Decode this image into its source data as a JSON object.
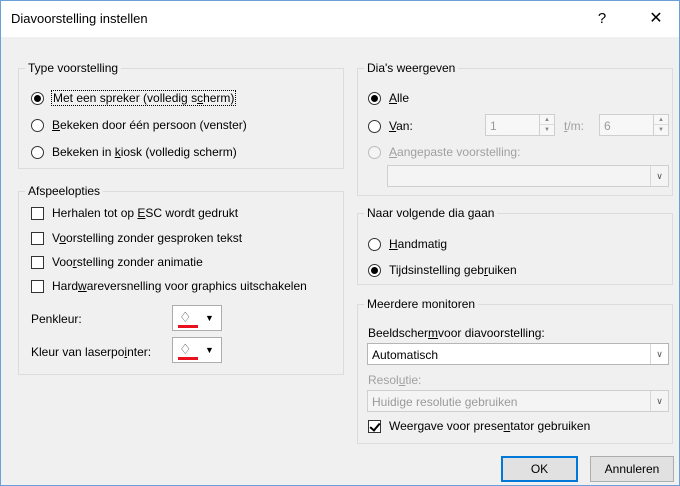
{
  "window": {
    "title": "Diavoorstelling instellen",
    "help": "?",
    "close": "✕"
  },
  "type_group": {
    "title": "Type voorstelling",
    "options": [
      {
        "pre": "Met een spreker (volledig s",
        "u": "c",
        "post": "herm)",
        "checked": true
      },
      {
        "pre": "",
        "u": "B",
        "post": "ekeken door één persoon (venster)",
        "checked": false
      },
      {
        "pre": "Bekeken in ",
        "u": "k",
        "post": "iosk (volledig scherm)",
        "checked": false
      }
    ]
  },
  "playback_group": {
    "title": "Afspeelopties",
    "options": [
      {
        "pre": "Herhalen tot op ",
        "u": "E",
        "post": "SC wordt gedrukt"
      },
      {
        "pre": "V",
        "u": "o",
        "post": "orstelling zonder gesproken tekst"
      },
      {
        "pre": "Voo",
        "u": "r",
        "post": "stelling zonder animatie"
      },
      {
        "pre": "Hard",
        "u": "w",
        "post": "areversnelling voor graphics uitschakelen"
      }
    ],
    "pen_color_label": "Penkleur:",
    "laser_color_label_pre": "Kleur van laserpo",
    "laser_color_label_u": "i",
    "laser_color_label_post": "nter:"
  },
  "slides_group": {
    "title": "Dia's weergeven",
    "all_pre": "",
    "all_u": "A",
    "all_post": "lle",
    "from_pre": "",
    "from_u": "V",
    "from_post": "an:",
    "from_value": "1",
    "to_pre": "",
    "to_u": "t",
    "to_post": "/m:",
    "to_value": "6",
    "custom_pre": "",
    "custom_u": "A",
    "custom_post": "angepaste voorstelling:",
    "custom_value": ""
  },
  "advance_group": {
    "title": "Naar volgende dia gaan",
    "manual_pre": "",
    "manual_u": "H",
    "manual_post": "andmatig",
    "timings_pre": "Tijdsinstelling geb",
    "timings_u": "r",
    "timings_post": "uiken"
  },
  "monitors_group": {
    "title": "Meerdere monitoren",
    "screen_label_pre": "Beeldscher",
    "screen_label_u": "m",
    "screen_label_post": " voor diavoorstelling:",
    "screen_value": "Automatisch",
    "resolution_label_pre": "Resol",
    "resolution_label_u": "u",
    "resolution_label_post": "tie:",
    "resolution_value": "Huidige resolutie gebruiken",
    "presenter_pre": "Weergave voor prese",
    "presenter_u": "n",
    "presenter_post": "tator gebruiken"
  },
  "buttons": {
    "ok": "OK",
    "cancel": "Annuleren"
  }
}
